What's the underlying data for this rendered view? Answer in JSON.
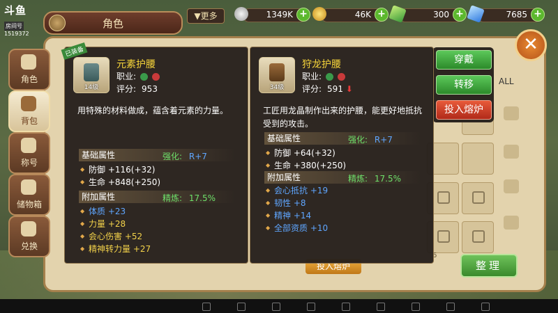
{
  "watermark": {
    "brand": "斗鱼",
    "room_label": "房间号",
    "room_id": "1519372"
  },
  "header": {
    "title": "角色",
    "more": "▼更多"
  },
  "currencies": [
    {
      "name": "silver",
      "icon": "silver-coin-icon",
      "value": "1349K"
    },
    {
      "name": "gold",
      "icon": "gold-coin-icon",
      "value": "46K"
    },
    {
      "name": "green-gem",
      "icon": "green-gem-icon",
      "value": "300"
    },
    {
      "name": "blue-diamond",
      "icon": "blue-diamond-icon",
      "value": "7685"
    }
  ],
  "sidebar": {
    "items": [
      {
        "label": "角色",
        "icon": "armor-icon"
      },
      {
        "label": "背包",
        "icon": "bag-icon"
      },
      {
        "label": "称号",
        "icon": "title-icon"
      },
      {
        "label": "储物箱",
        "icon": "storage-icon"
      },
      {
        "label": "兑换",
        "icon": "exchange-icon"
      }
    ]
  },
  "actions": {
    "equip": "穿戴",
    "transfer": "转移",
    "smelt": "投入熔炉"
  },
  "inventory": {
    "all_tab": "ALL",
    "sort": "整理",
    "smelt_bottom": "投入熔炉",
    "corner_num": "6"
  },
  "item_left": {
    "badge": "已装备",
    "name": "元素护腰",
    "level": "14级",
    "job_label": "职业:",
    "score_label": "评分:",
    "score": "953",
    "desc": "用特殊的材料做成，蕴含着元素的力量。",
    "base_title": "基础属性",
    "enhance_label": "强化:",
    "enhance_value": "R+7",
    "base_attrs": [
      "防御 +116(+32)",
      "生命 +848(+250)"
    ],
    "extra_title": "附加属性",
    "refine_label": "精炼:",
    "refine_value": "17.5%",
    "extra_attrs": [
      {
        "name": "体质",
        "value": "+23"
      },
      {
        "name": "力量",
        "value": "+28"
      },
      {
        "name": "会心伤害",
        "value": "+52"
      },
      {
        "name": "精神转力量",
        "value": "+27"
      }
    ]
  },
  "item_right": {
    "name": "狩龙护腰",
    "level": "34级",
    "job_label": "职业:",
    "score_label": "评分:",
    "score": "591",
    "desc": "工匠用龙晶制作出来的护腰，能更好地抵抗受到的攻击。",
    "base_title": "基础属性",
    "enhance_label": "强化:",
    "enhance_value": "R+7",
    "base_attrs": [
      "防御 +64(+32)",
      "生命 +380(+250)"
    ],
    "extra_title": "附加属性",
    "refine_label": "精炼:",
    "refine_value": "17.5%",
    "extra_attrs": [
      {
        "name": "会心抵抗",
        "value": "+19"
      },
      {
        "name": "韧性",
        "value": "+8"
      },
      {
        "name": "精神",
        "value": "+14"
      },
      {
        "name": "全部资质",
        "value": "+10"
      }
    ]
  }
}
